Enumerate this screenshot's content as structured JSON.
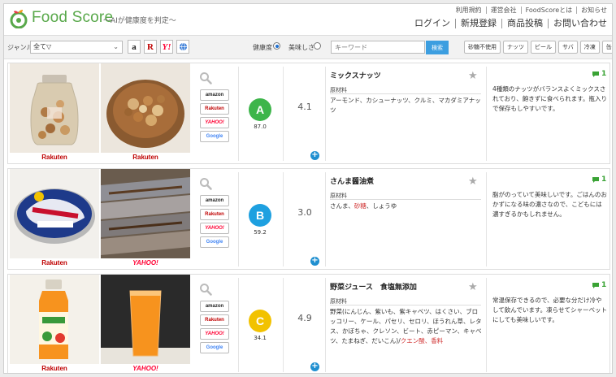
{
  "header": {
    "logo_text": "Food Score",
    "tagline": "〜AIが健康度を判定〜",
    "util_links": [
      "利用規約",
      "運営会社",
      "FoodScoreとは",
      "お知らせ"
    ],
    "main_links": [
      "ログイン",
      "新規登録",
      "商品投稿",
      "お問い合わせ"
    ]
  },
  "filter": {
    "genre_label": "ジャンル",
    "genre_value": "全て▽",
    "sort_health": "健康度",
    "sort_taste": "美味しさ",
    "keyword_placeholder": "キーワード",
    "search_label": "検索",
    "chips": [
      "砂糖不使用",
      "ナッツ",
      "ビール",
      "サバ",
      "冷凍",
      "缶詰"
    ]
  },
  "stores": {
    "amazon": "amazon",
    "rakuten": "Rakuten",
    "yahoo": "YAHOO!",
    "google": "Google"
  },
  "colors": {
    "grade_a": "#3db54a",
    "grade_b": "#1ea0e0",
    "grade_c": "#f2c200",
    "accent_blue": "#3c9ee0",
    "brand_green": "#58a84a"
  },
  "products": [
    {
      "img_left_label": "Rakuten",
      "img_right_label": "Rakuten",
      "grade": "A",
      "grade_score": "87.0",
      "rating": "4.1",
      "name": "ミックスナッツ",
      "ingredients_title": "原材料",
      "ingredients": "アーモンド、カシューナッツ、クルミ、マカダミアナッツ",
      "ingredients_warn": "",
      "ingredients_rest": "",
      "comment_count": "1",
      "comment": "4種類のナッツがバランスよくミックスされており、飽きずに食べられます。瓶入りで保存もしやすいです。"
    },
    {
      "img_left_label": "Rakuten",
      "img_right_label": "YAHOO!",
      "grade": "B",
      "grade_score": "59.2",
      "rating": "3.0",
      "name": "さんま醤油煮",
      "ingredients_title": "原材料",
      "ingredients": "さんま、",
      "ingredients_warn": "砂糖",
      "ingredients_rest": "、しょうゆ",
      "comment_count": "1",
      "comment": "脂がのっていて美味しいです。ごはんのおかずになる味の濃さなので、こどもには濃すぎるかもしれません。"
    },
    {
      "img_left_label": "Rakuten",
      "img_right_label": "YAHOO!",
      "grade": "C",
      "grade_score": "34.1",
      "rating": "4.9",
      "name": "野菜ジュース　食塩無添加",
      "ingredients_title": "原材料",
      "ingredients": "野菜(にんじん、紫いも、紫キャベツ、はくさい、ブロッコリー、ケール、パセリ、セロリ、ほうれん草、レタス、かぼちゃ、クレソン、ビート、赤ピーマン、キャベツ、たまねぎ、だいこん)/",
      "ingredients_warn": "クエン酸、香料",
      "ingredients_rest": "",
      "comment_count": "1",
      "comment": "常温保存できるので、必要な分だけ冷やして飲んでいます。凍らせてシャーベットにしても美味しいです。"
    }
  ]
}
